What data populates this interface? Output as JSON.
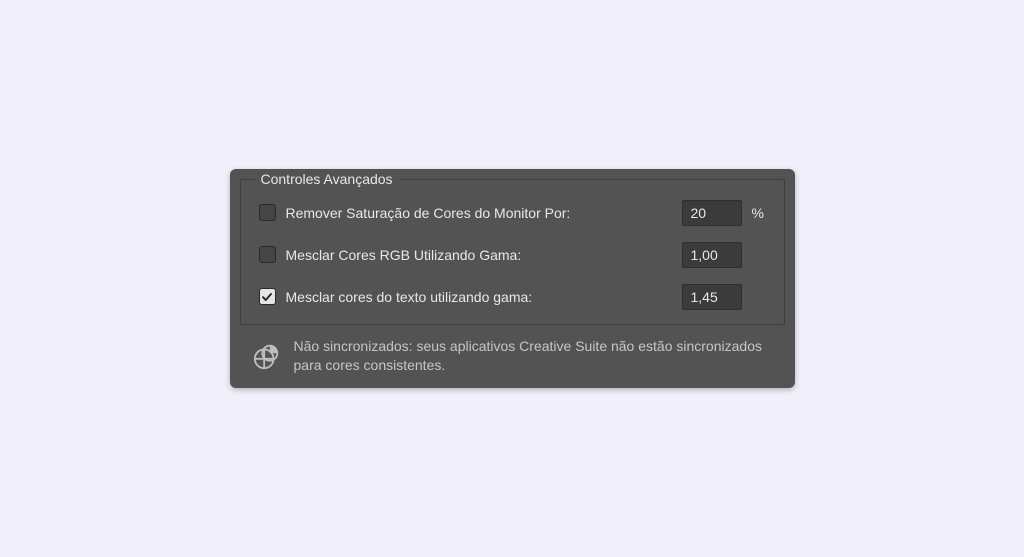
{
  "fieldset": {
    "legend": "Controles Avançados",
    "rows": [
      {
        "label": "Remover Saturação de Cores do Monitor Por:",
        "value": "20",
        "suffix": "%",
        "checked": false
      },
      {
        "label": "Mesclar Cores RGB Utilizando Gama:",
        "value": "1,00",
        "suffix": "",
        "checked": false
      },
      {
        "label": "Mesclar cores do texto utilizando gama:",
        "value": "1,45",
        "suffix": "",
        "checked": true
      }
    ]
  },
  "syncNote": "Não sincronizados: seus aplicativos Creative Suite não estão sincronizados para cores consistentes."
}
